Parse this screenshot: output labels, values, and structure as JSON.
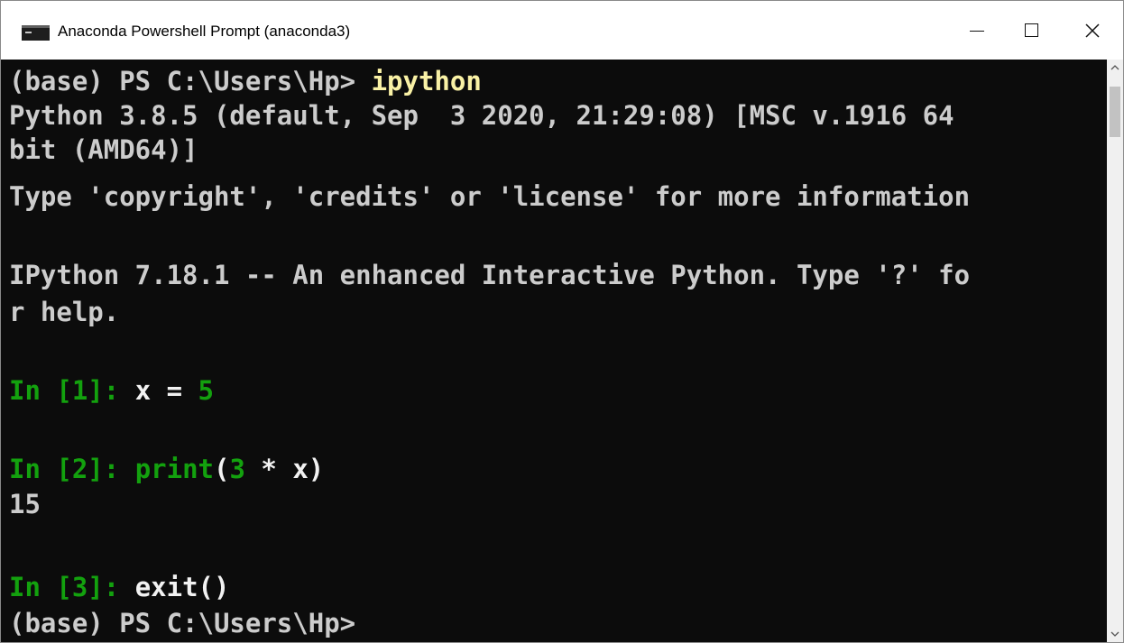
{
  "window": {
    "title": "Anaconda Powershell Prompt (anaconda3)"
  },
  "console": {
    "l1": {
      "prompt": "(base) PS C:\\Users\\Hp> ",
      "cmd": "ipython"
    },
    "l2": "Python 3.8.5 (default, Sep  3 2020, 21:29:08) [MSC v.1916 64",
    "l3": "bit (AMD64)]",
    "l4": "Type 'copyright', 'credits' or 'license' for more information",
    "l6": "IPython 7.18.1 -- An enhanced Interactive Python. Type '?' fo",
    "l7": "r help.",
    "in1": {
      "prompt": "In [1]: ",
      "code_a": "x = ",
      "code_b": "5"
    },
    "in2": {
      "prompt": "In [2]: ",
      "code_a": "print",
      "code_b": "(",
      "code_c": "3",
      "code_d": " * x)"
    },
    "out2": "15",
    "in3": {
      "prompt": "In [3]: ",
      "code_a": "exit()"
    },
    "final_prompt": "(base) PS C:\\Users\\Hp>"
  },
  "colors": {
    "console_bg": "#0c0c0c",
    "text": "#cccccc",
    "command": "#f9f1a5",
    "ipython_prompt": "#13a10e"
  },
  "icons": {
    "app": "console-window-icon",
    "minimize": "minimize-icon",
    "maximize": "maximize-icon",
    "close": "close-icon",
    "scroll_up": "chevron-up-icon",
    "scroll_down": "chevron-down-icon"
  }
}
